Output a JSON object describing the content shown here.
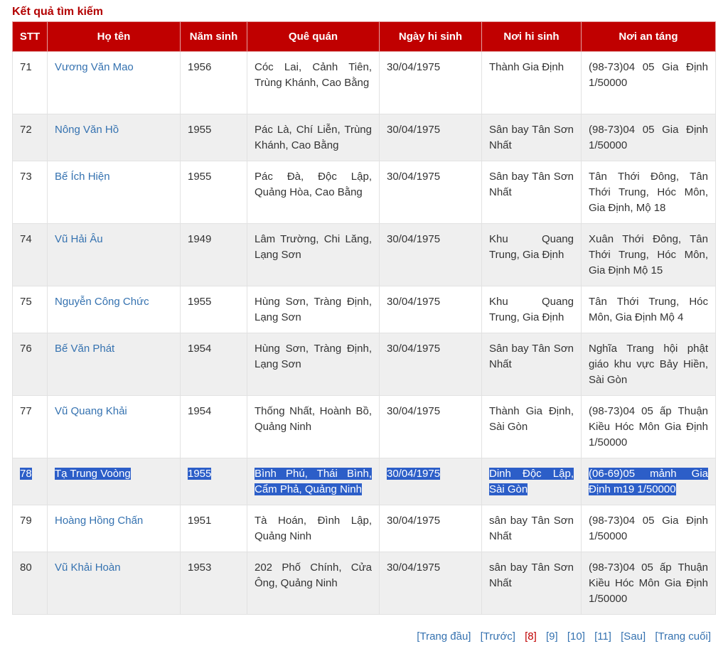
{
  "title": "Kết quả tìm kiếm",
  "columns": [
    "STT",
    "Họ tên",
    "Năm sinh",
    "Quê quán",
    "Ngày hi sinh",
    "Nơi hi sinh",
    "Nơi an táng"
  ],
  "rows": [
    {
      "stt": "71",
      "name": "Vương Văn Mao",
      "year": "1956",
      "hometown": "Cóc Lai, Cảnh Tiên, Trùng Khánh, Cao Bằng",
      "date": "30/04/1975",
      "death_place": "Thành Gia Định",
      "burial": "(98-73)04 05 Gia Định 1/50000"
    },
    {
      "stt": "72",
      "name": "Nông Văn Hồ",
      "year": "1955",
      "hometown": "Pác Là, Chí Liễn, Trùng Khánh, Cao Bằng",
      "date": "30/04/1975",
      "death_place": "Sân bay Tân Sơn Nhất",
      "burial": "(98-73)04 05 Gia Định 1/50000"
    },
    {
      "stt": "73",
      "name": "Bế Ích Hiện",
      "year": "1955",
      "hometown": "Pác Đà, Độc Lập, Quảng Hòa, Cao Bằng",
      "date": "30/04/1975",
      "death_place": "Sân bay Tân Sơn Nhất",
      "burial": "Tân Thới Đông, Tân Thới Trung, Hóc Môn, Gia Định, Mộ 18"
    },
    {
      "stt": "74",
      "name": "Vũ Hải Âu",
      "year": "1949",
      "hometown": "Lâm Trường, Chi Lăng, Lạng Sơn",
      "date": "30/04/1975",
      "death_place": "Khu Quang Trung, Gia Định",
      "burial": "Xuân Thới Đông, Tân Thới Trung, Hóc Môn, Gia Định Mộ 15"
    },
    {
      "stt": "75",
      "name": "Nguyễn Công Chức",
      "year": "1955",
      "hometown": "Hùng Sơn, Tràng Định, Lạng Sơn",
      "date": "30/04/1975",
      "death_place": "Khu Quang Trung, Gia Định",
      "burial": "Tân Thới Trung, Hóc Môn, Gia Định Mộ 4"
    },
    {
      "stt": "76",
      "name": "Bế Văn Phát",
      "year": "1954",
      "hometown": "Hùng Sơn, Tràng Định, Lạng Sơn",
      "date": "30/04/1975",
      "death_place": "Sân bay Tân Sơn Nhất",
      "burial": "Nghĩa Trang hội phật giáo khu vực Bảy Hiền, Sài Gòn"
    },
    {
      "stt": "77",
      "name": "Vũ Quang Khải",
      "year": "1954",
      "hometown": "Thống Nhất, Hoành Bồ, Quảng Ninh",
      "date": "30/04/1975",
      "death_place": "Thành Gia Định, Sài Gòn",
      "burial": "(98-73)04 05 ấp Thuận Kiều Hóc Môn Gia Định 1/50000"
    },
    {
      "stt": "78",
      "name": "Tạ Trung Voòng",
      "year": "1955",
      "hometown": "Bình Phú, Thái Bình, Cẩm Phả, Quảng Ninh",
      "date": "30/04/1975",
      "death_place": "Dinh Độc Lập, Sài Gòn",
      "burial": "(06-69)05 mảnh Gia Định m19 1/50000"
    },
    {
      "stt": "79",
      "name": "Hoàng Hồng Chấn",
      "year": "1951",
      "hometown": "Tà Hoán, Đình Lập, Quảng Ninh",
      "date": "30/04/1975",
      "death_place": "sân bay Tân Sơn Nhất",
      "burial": "(98-73)04 05 Gia Định 1/50000"
    },
    {
      "stt": "80",
      "name": "Vũ Khải Hoàn",
      "year": "1953",
      "hometown": "202 Phố Chính, Cửa Ông, Quảng Ninh",
      "date": "30/04/1975",
      "death_place": "sân bay Tân Sơn Nhất",
      "burial": "(98-73)04 05 ấp Thuận Kiều Hóc Môn Gia Định 1/50000"
    }
  ],
  "selected_stt": "78",
  "pagination": {
    "first": "[Trang đầu]",
    "prev": "[Trước]",
    "pages": [
      "[8]",
      "[9]",
      "[10]",
      "[11]"
    ],
    "current": "[8]",
    "next": "[Sau]",
    "last": "[Trang cuối]"
  },
  "colors": {
    "header_bg": "#c00000",
    "title": "#b30000",
    "link": "#3572b0",
    "selection": "#2c5ec8"
  }
}
